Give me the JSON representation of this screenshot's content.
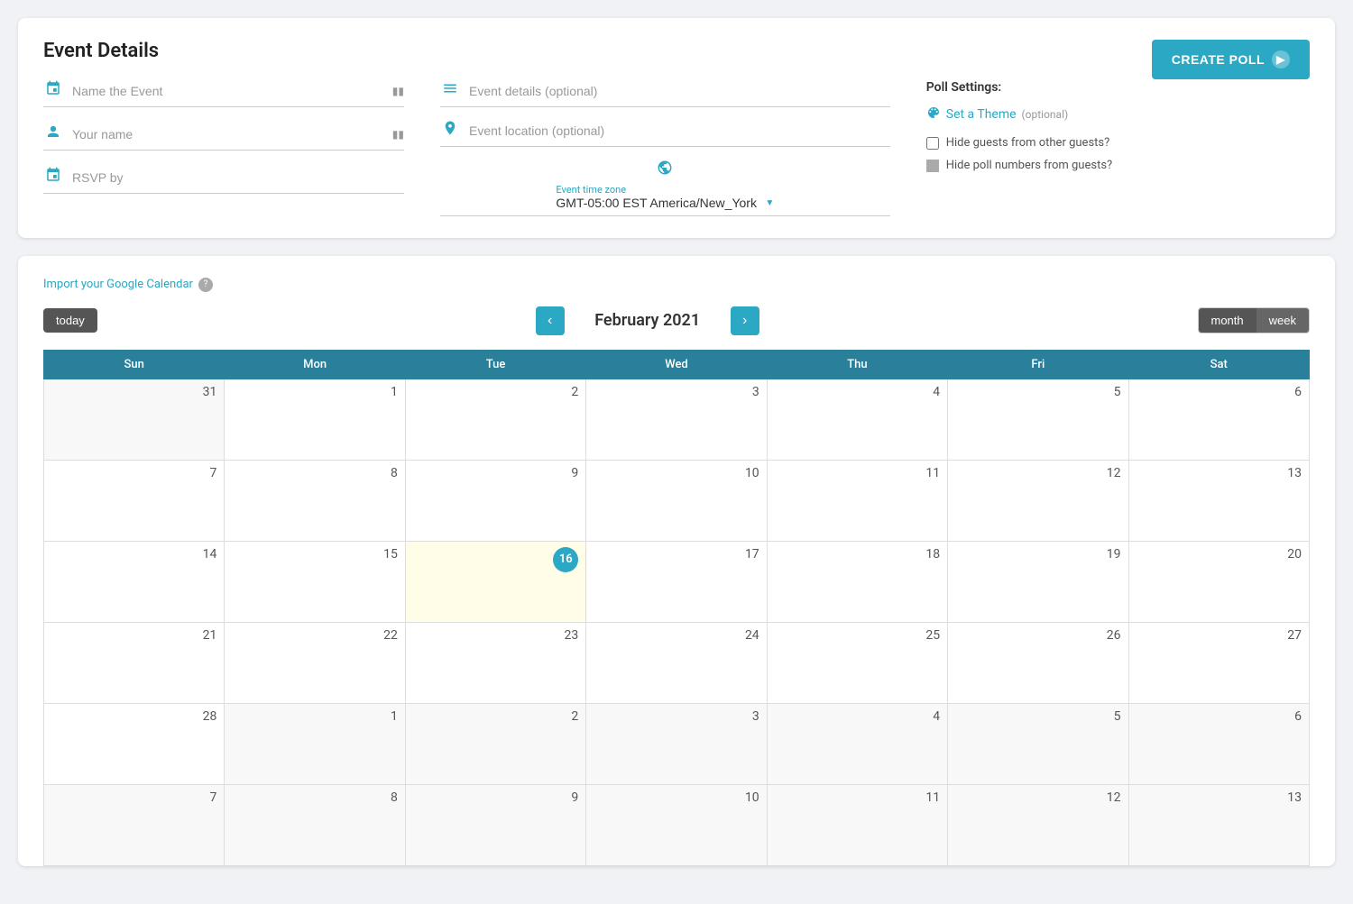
{
  "header": {
    "title": "Event Details",
    "create_poll_label": "CREATE POLL"
  },
  "form": {
    "left": {
      "event_name_label": "Name the Event",
      "event_name_required": "*",
      "your_name_label": "Your name",
      "your_name_required": "*",
      "rsvp_label": "RSVP by",
      "rsvp_required": "*"
    },
    "middle": {
      "event_details_placeholder": "Event details (optional)",
      "event_location_placeholder": "Event location (optional)",
      "timezone_label": "Event time zone",
      "timezone_value": "GMT-05:00 EST America/New_York"
    },
    "right": {
      "poll_settings_title": "Poll Settings:",
      "set_theme_label": "Set a Theme",
      "set_theme_optional": "(optional)",
      "hide_guests_label": "Hide guests from other guests?",
      "hide_poll_label": "Hide poll numbers from guests?"
    }
  },
  "calendar": {
    "import_link": "Import your Google Calendar",
    "today_label": "today",
    "month_title": "February 2021",
    "view_month": "month",
    "view_week": "week",
    "days_of_week": [
      "Sun",
      "Mon",
      "Tue",
      "Wed",
      "Thu",
      "Fri",
      "Sat"
    ],
    "today_date": 16,
    "weeks": [
      [
        {
          "day": 31,
          "other": true
        },
        {
          "day": 1
        },
        {
          "day": 2
        },
        {
          "day": 3
        },
        {
          "day": 4
        },
        {
          "day": 5
        },
        {
          "day": 6
        }
      ],
      [
        {
          "day": 7
        },
        {
          "day": 8
        },
        {
          "day": 9
        },
        {
          "day": 10
        },
        {
          "day": 11
        },
        {
          "day": 12
        },
        {
          "day": 13
        }
      ],
      [
        {
          "day": 14
        },
        {
          "day": 15
        },
        {
          "day": 16,
          "today": true
        },
        {
          "day": 17
        },
        {
          "day": 18
        },
        {
          "day": 19
        },
        {
          "day": 20
        }
      ],
      [
        {
          "day": 21
        },
        {
          "day": 22
        },
        {
          "day": 23
        },
        {
          "day": 24
        },
        {
          "day": 25
        },
        {
          "day": 26
        },
        {
          "day": 27
        }
      ],
      [
        {
          "day": 28
        },
        {
          "day": 1,
          "other": true
        },
        {
          "day": 2,
          "other": true
        },
        {
          "day": 3,
          "other": true
        },
        {
          "day": 4,
          "other": true
        },
        {
          "day": 5,
          "other": true
        },
        {
          "day": 6,
          "other": true
        }
      ],
      [
        {
          "day": 7,
          "other": true
        },
        {
          "day": 8,
          "other": true
        },
        {
          "day": 9,
          "other": true
        },
        {
          "day": 10,
          "other": true
        },
        {
          "day": 11,
          "other": true
        },
        {
          "day": 12,
          "other": true
        },
        {
          "day": 13,
          "other": true
        }
      ]
    ]
  },
  "colors": {
    "teal": "#2aa8c4",
    "dark_teal": "#2a7f9a",
    "today_bg": "#fffde7"
  }
}
